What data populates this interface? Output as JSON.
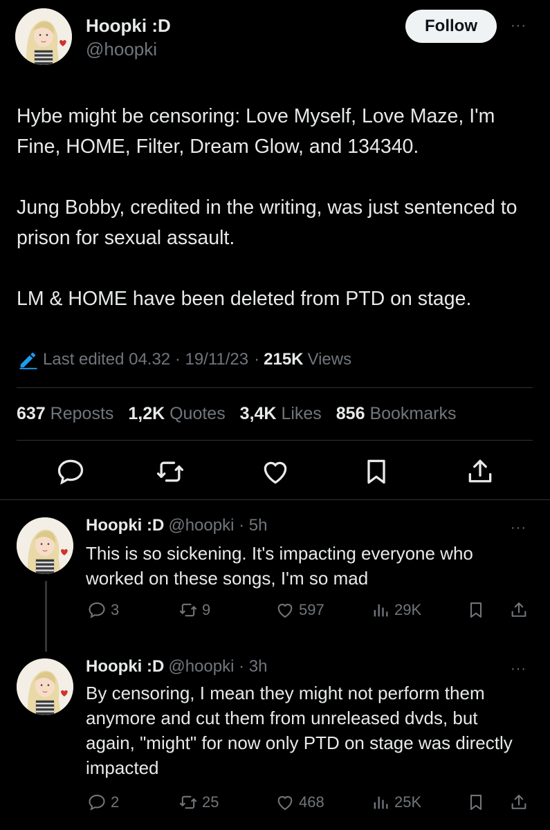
{
  "tweet": {
    "display_name": "Hoopki :D",
    "handle": "@hoopki",
    "follow_label": "Follow",
    "more": "···",
    "paragraphs": [
      "Hybe might be censoring: Love Myself, Love Maze, I'm Fine, HOME, Filter, Dream Glow, and 134340.",
      "Jung Bobby, credited in the writing, was just sentenced to prison for sexual assault.",
      "LM & HOME have been deleted from PTD on stage."
    ],
    "edited_label": "Last edited 04.32 · 19/11/23",
    "separator": "·",
    "views_count": "215K",
    "views_label": "Views",
    "stats": [
      {
        "count": "637",
        "label": "Reposts"
      },
      {
        "count": "1,2K",
        "label": "Quotes"
      },
      {
        "count": "3,4K",
        "label": "Likes"
      },
      {
        "count": "856",
        "label": "Bookmarks"
      }
    ]
  },
  "replies": [
    {
      "display_name": "Hoopki :D",
      "handle": "@hoopki · 5h",
      "text": "This is so sickening. It's impacting everyone who worked on these songs, I'm so mad",
      "replies": "3",
      "reposts": "9",
      "likes": "597",
      "views": "29K",
      "more": "···"
    },
    {
      "display_name": "Hoopki :D",
      "handle": "@hoopki · 3h",
      "text": "By censoring, I mean they might not perform them anymore and cut them from unreleased dvds, but again, \"might\" for now only PTD on stage was directly impacted",
      "replies": "2",
      "reposts": "25",
      "likes": "468",
      "views": "25K",
      "more": "···"
    }
  ],
  "colors": {
    "background": "#000000",
    "text": "#e7e9ea",
    "muted": "#71767b",
    "edit_icon": "#1d9bf0",
    "divider": "#2f3336"
  }
}
